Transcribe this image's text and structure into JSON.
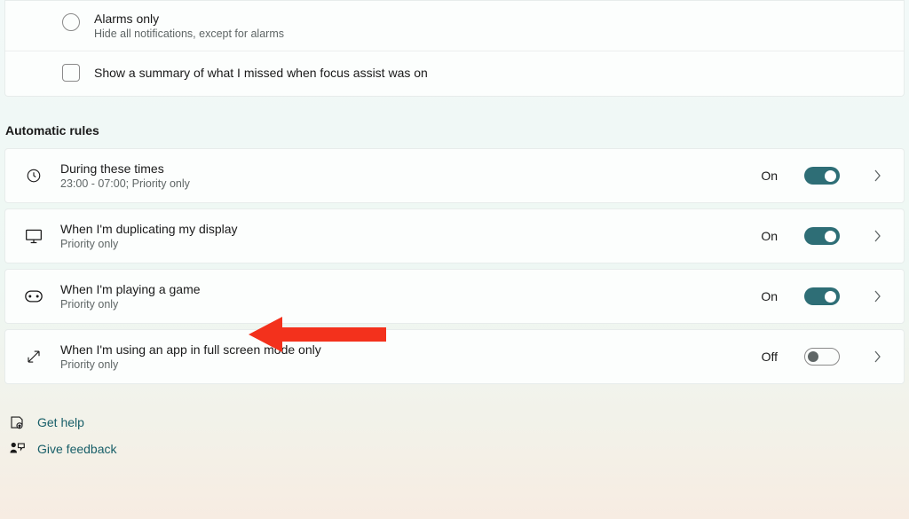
{
  "options": {
    "alarms_only": {
      "title": "Alarms only",
      "sub": "Hide all notifications, except for alarms"
    },
    "summary_checkbox": {
      "label": "Show a summary of what I missed when focus assist was on"
    }
  },
  "section_header": "Automatic rules",
  "rules": {
    "times": {
      "title": "During these times",
      "sub": "23:00 - 07:00; Priority only",
      "status": "On"
    },
    "duplicating": {
      "title": "When I'm duplicating my display",
      "sub": "Priority only",
      "status": "On"
    },
    "gaming": {
      "title": "When I'm playing a game",
      "sub": "Priority only",
      "status": "On"
    },
    "fullscreen": {
      "title": "When I'm using an app in full screen mode only",
      "sub": "Priority only",
      "status": "Off"
    }
  },
  "links": {
    "help": "Get help",
    "feedback": "Give feedback"
  },
  "colors": {
    "accent": "#2e6e76",
    "link": "#175e68",
    "arrow": "#F3311C"
  }
}
